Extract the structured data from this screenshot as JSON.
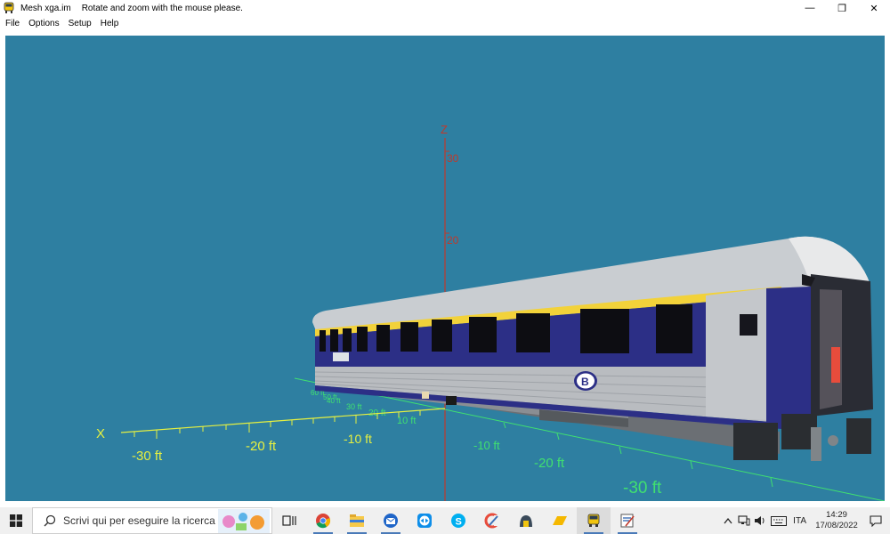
{
  "window": {
    "title": "Mesh xga.im",
    "hint": "Rotate and zoom with the mouse please.",
    "minimize_glyph": "—",
    "maximize_glyph": "❐",
    "close_glyph": "✕"
  },
  "menu": [
    {
      "label": "File"
    },
    {
      "label": "Options"
    },
    {
      "label": "Setup"
    },
    {
      "label": "Help"
    }
  ],
  "viewport": {
    "background": "#2e7fa1",
    "axes": {
      "z_label": "Z",
      "x_label": "X",
      "z_ticks": [
        "30",
        "20"
      ],
      "x_ticks": [
        "-30 ft",
        "-20 ft",
        "-10 ft"
      ],
      "y_ticks": [
        "10 ft",
        "-10 ft",
        "-20 ft",
        "-30 ft"
      ],
      "y_small_ticks": [
        "60 ft",
        "50 ft",
        "40 ft",
        "30 ft",
        "20 ft"
      ],
      "z_color": "#c0392b",
      "x_color": "#e6f040",
      "y_color": "#40e070"
    },
    "coach": {
      "logo_letter": "B",
      "body_color": "#2c2f86",
      "stripe_color": "#f2d23a",
      "lower_color": "#b9bcc0"
    }
  },
  "taskbar": {
    "search_placeholder": "Scrivi qui per eseguire la ricerca",
    "apps": [
      {
        "name": "task-view"
      },
      {
        "name": "chrome"
      },
      {
        "name": "file-explorer"
      },
      {
        "name": "thunderbird"
      },
      {
        "name": "teamviewer"
      },
      {
        "name": "skype"
      },
      {
        "name": "ccleaner"
      },
      {
        "name": "app-dome"
      },
      {
        "name": "app-yellow"
      },
      {
        "name": "mesh-app"
      },
      {
        "name": "app-tool"
      }
    ],
    "tray": {
      "language": "ITA",
      "time": "14:29",
      "date": "17/08/2022"
    }
  }
}
